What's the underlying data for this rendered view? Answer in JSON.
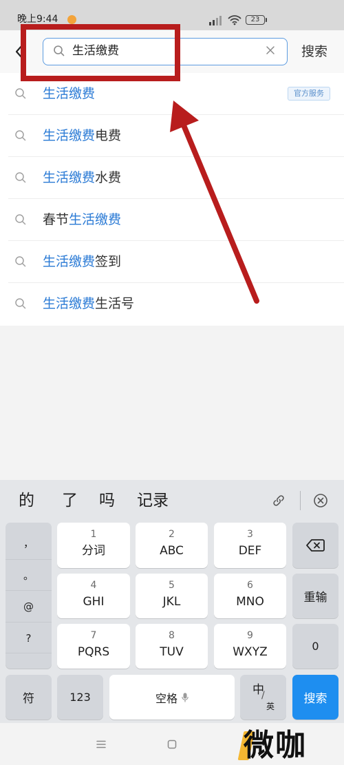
{
  "colors": {
    "accent": "#2a7ad5",
    "input_border": "#5c9be0",
    "annotation": "#b81d1d",
    "search_key": "#1e8ef0",
    "badge_text": "#5a8fcb",
    "badge_background": "#edf4fc",
    "badge_border": "#bcd6f1",
    "keyboard_background": "#e4e6e9",
    "key_gray": "#d3d6db"
  },
  "status_bar": {
    "time": "晚上9:44",
    "battery": "23",
    "icons": [
      "notification-icon",
      "signal-icon",
      "wifi-icon",
      "battery-icon"
    ]
  },
  "header": {
    "back_icon": "chevron-left-icon",
    "search_icon": "search-icon",
    "clear_icon": "close-icon",
    "query": "生活缴费",
    "search_label": "搜索"
  },
  "suggestions": [
    {
      "highlight": "生活缴费",
      "badge": "官方服务"
    },
    {
      "highlight": "生活缴费",
      "after": "电费"
    },
    {
      "highlight": "生活缴费",
      "after": "水费"
    },
    {
      "before": "春节",
      "highlight": "生活缴费"
    },
    {
      "highlight": "生活缴费",
      "after": "签到"
    },
    {
      "highlight": "生活缴费",
      "after": "生活号"
    }
  ],
  "keyboard": {
    "candidates": [
      "的",
      "了",
      "吗",
      "记录"
    ],
    "toolbar_icons": [
      "link-icon",
      "close-circle-icon"
    ],
    "punctuation": [
      "，",
      "。",
      "@",
      "?"
    ],
    "keys": [
      {
        "num": "1",
        "label": "分词"
      },
      {
        "num": "2",
        "label": "ABC"
      },
      {
        "num": "3",
        "label": "DEF"
      },
      {
        "num": "4",
        "label": "GHI"
      },
      {
        "num": "5",
        "label": "JKL"
      },
      {
        "num": "6",
        "label": "MNO"
      },
      {
        "num": "7",
        "label": "PQRS"
      },
      {
        "num": "8",
        "label": "TUV"
      },
      {
        "num": "9",
        "label": "WXYZ"
      }
    ],
    "side": {
      "backspace_icon": "backspace-icon",
      "reenter": "重输",
      "zero": "0"
    },
    "bottom": {
      "symbols": "符",
      "numbers": "123",
      "space": "空格",
      "space_icon": "microphone-icon",
      "lang_primary": "中",
      "lang_separator": "/",
      "lang_secondary": "英",
      "search": "搜索"
    }
  },
  "nav_bar": {
    "icons": [
      "menu-icon",
      "home-icon"
    ]
  },
  "watermark": "微咖"
}
